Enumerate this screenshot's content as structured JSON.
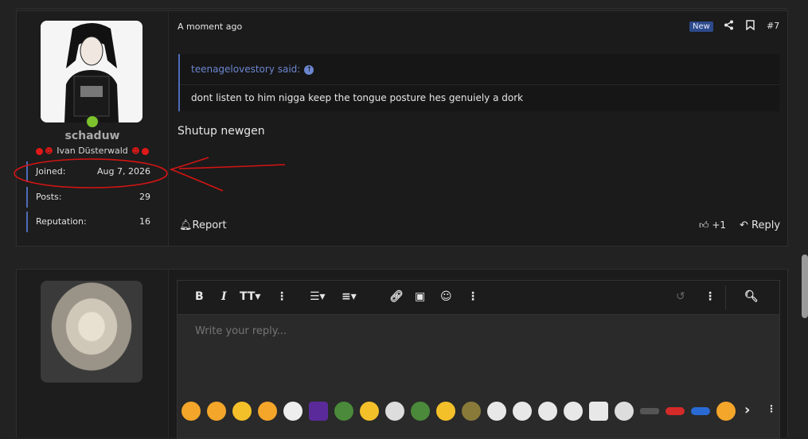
{
  "post": {
    "username": "schaduw",
    "user_title": "Ivan Düsterwald",
    "stats": [
      {
        "key": "Joined:",
        "value": "Aug 7, 2026"
      },
      {
        "key": "Posts:",
        "value": "29"
      },
      {
        "key": "Reputation:",
        "value": "16"
      }
    ],
    "timestamp": "A moment ago",
    "new_badge": "New",
    "post_number": "#7",
    "quote_author": "teenagelovestory said:",
    "quote_body": "dont listen to him nigga keep the tongue posture hes genuiely a dork",
    "message": "Shutup newgen",
    "report_label": "Report",
    "like_count": "+1",
    "reply_label": "Reply"
  },
  "editor": {
    "placeholder": "Write your reply..."
  },
  "colors": {
    "accent": "#4d6bb7",
    "online": "#7dc22c",
    "annotation": "#d41414"
  }
}
